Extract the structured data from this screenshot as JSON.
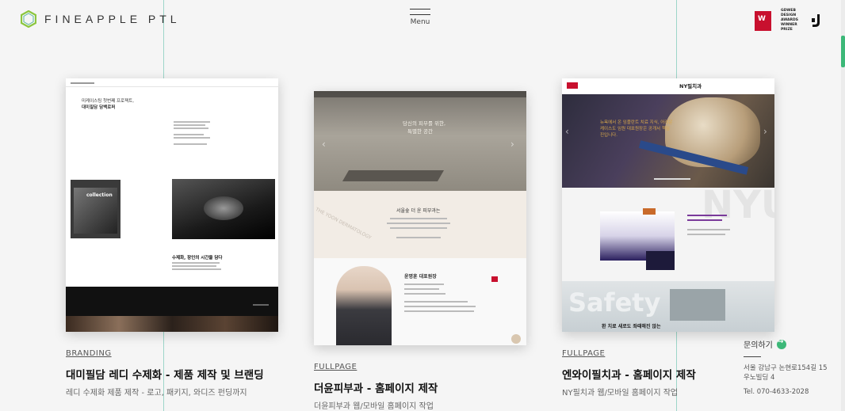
{
  "header": {
    "logo_text": "FINEAPPLE PTL",
    "menu_label": "Menu",
    "award_badge": "W",
    "award_text": "GDWEB DESIGN AWARDS WINNER PRIZE"
  },
  "colors": {
    "accent": "#3cb878",
    "line": "#9dd6c9",
    "award": "#c8102e"
  },
  "portfolio": [
    {
      "tag": "BRANDING",
      "title": "대미필담 레디 수제화 - 제품 제작 및 브랜딩",
      "desc": "레디 수제화 제품 제작 - 로고, 패키지, 와디즈 펀딩까지",
      "thumb": {
        "heading1": "미케이스팅 첫번째 프로젝트,",
        "heading2": "대미필담 담백로퍼",
        "collection": "collection",
        "subhead": "수제화, 장인의 시간을 담다"
      }
    },
    {
      "tag": "FULLPAGE",
      "title": "더윤피부과 - 홈페이지 제작",
      "desc": "더윤피부과 웹/모바일 홈페이지 작업",
      "thumb": {
        "hero1": "당신의 피부를 위한,",
        "hero2": "특별한 공간",
        "intro": "서울숲 더 윤 피부과는",
        "doctor": "윤명훈 대표원장",
        "brand": "THE YOON DERMATOLOGY"
      }
    },
    {
      "tag": "FULLPAGE",
      "title": "엔와이필치과 - 홈페이지 제작",
      "desc": "NY필치과 웹/모바일 홈페이지 작업",
      "thumb": {
        "brand": "NY필치과",
        "hero": "뉴욕에서 온 임플란트 치료 지식, 어려운 케이스도 임원 대표원장은 공개서 책임진입니다.",
        "nyu": "NYU",
        "safety": "Safety",
        "bottom": "환 치료 새로도 좌때해진 않는"
      }
    }
  ],
  "contact": {
    "label": "문의하기",
    "address": "서울 강남구 논현로154길 15 우노빌딩 4",
    "tel": "Tel. 070-4633-2028"
  }
}
